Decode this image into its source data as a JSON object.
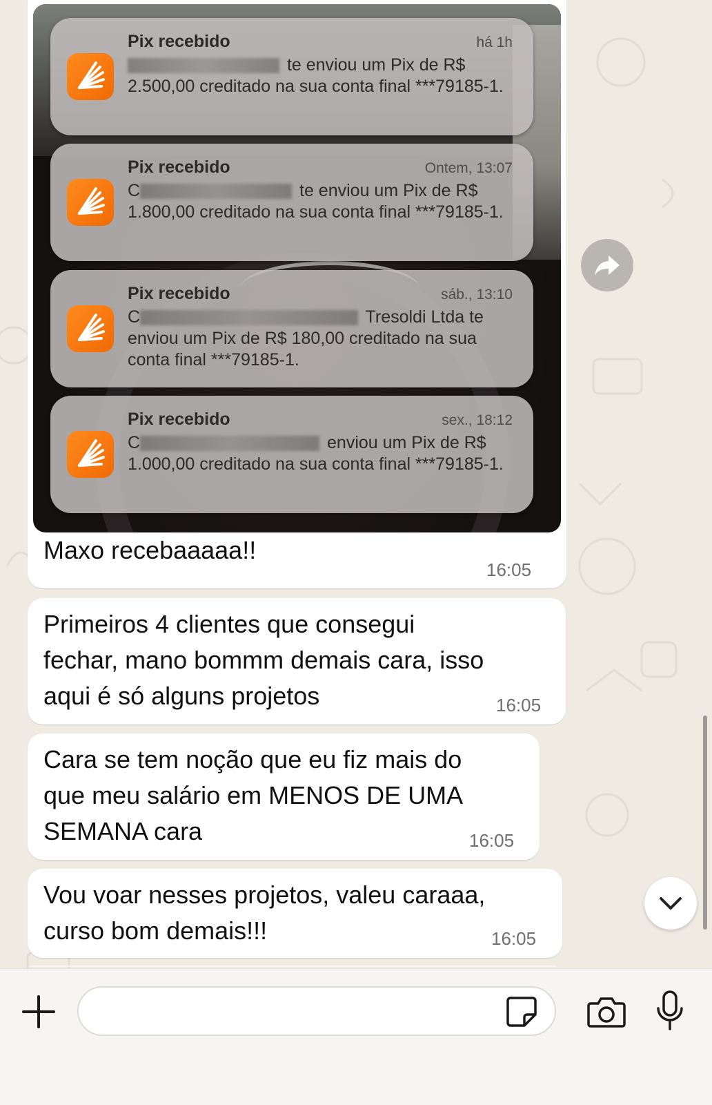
{
  "notifications": [
    {
      "title": "Pix recebido",
      "time": "há 1h",
      "body_prefix": "",
      "body": " te enviou um Pix de R$ 2.500,00 creditado na sua conta final ***79185-1."
    },
    {
      "title": "Pix recebido",
      "time": "Ontem, 13:07",
      "body_prefix": "C",
      "body": " te enviou um Pix de R$ 1.800,00 creditado na sua conta final ***79185-1."
    },
    {
      "title": "Pix recebido",
      "time": "sáb., 13:10",
      "body_prefix": "C",
      "body": " Tresoldi Ltda te enviou um Pix de R$ 180,00 creditado na sua conta final ***79185-1."
    },
    {
      "title": "Pix recebido",
      "time": "sex., 18:12",
      "body_prefix": "C",
      "body": " enviou um Pix de R$ 1.000,00 creditado na sua conta final ***79185-1."
    }
  ],
  "messages": [
    {
      "text": "Maxo recebaaaaa!!",
      "time": "16:05"
    },
    {
      "lines": [
        "Primeiros 4 clientes que consegui",
        "fechar, mano bommm demais cara, isso",
        "aqui é só alguns projetos"
      ],
      "time": "16:05"
    },
    {
      "lines": [
        "Cara se tem noção que eu fiz mais do",
        "que meu salário em MENOS DE UMA",
        "SEMANA cara"
      ],
      "time": "16:05"
    },
    {
      "lines": [
        "Vou voar nesses projetos, valeu caraaa,",
        "curso bom demais!!!"
      ],
      "time": "16:05"
    }
  ],
  "input": {
    "value": "",
    "placeholder": ""
  },
  "icons": {
    "forward": "forward-arrow-icon",
    "scroll_down": "chevron-down-icon",
    "plus": "plus-icon",
    "sticker": "sticker-icon",
    "camera": "camera-icon",
    "mic": "microphone-icon",
    "app": "bank-app-icon"
  },
  "colors": {
    "notif_icon": "#f47314",
    "bubble": "#ffffff",
    "background": "#efeae2"
  }
}
